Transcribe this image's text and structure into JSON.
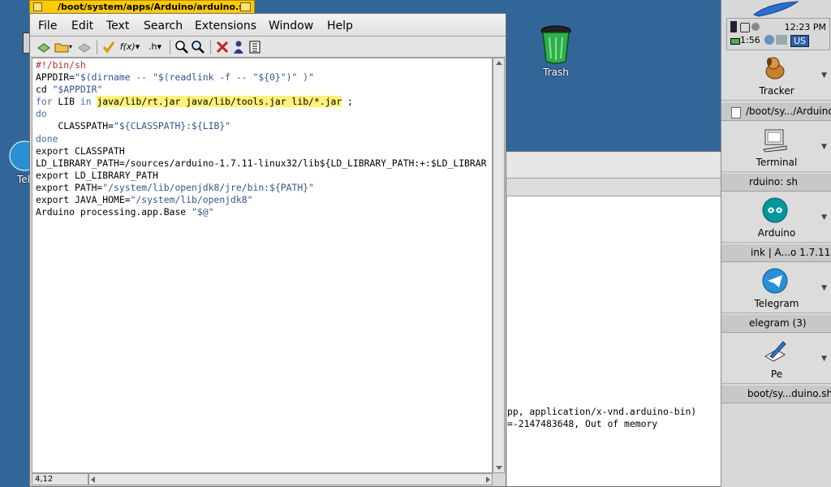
{
  "desktop": {
    "trash_label": "Trash",
    "left_icon_label": "Tel"
  },
  "pe": {
    "title": "/boot/system/apps/Arduino/arduino.sh",
    "menu": [
      "File",
      "Edit",
      "Text",
      "Search",
      "Extensions",
      "Window",
      "Help"
    ],
    "toolbar_func_label": "f(x)",
    "toolbar_header_label": ".h",
    "status": "4,12"
  },
  "code": {
    "l1": "#!/bin/sh",
    "l2a": "APPDIR=",
    "l2b": "\"$(dirname -- \"$(readlink -f -- \"${0}\")\" )\"",
    "l3a": "cd ",
    "l3b": "\"$APPDIR\"",
    "l4a": "for",
    "l4b": " LIB ",
    "l4c": "in",
    "l4d": " ",
    "l4e": "java/lib/rt.jar java/lib/tools.jar lib/*.jar",
    "l4f": " ;",
    "l5": "do",
    "l6a": "    CLASSPATH=",
    "l6b": "\"${CLASSPATH}:${LIB}\"",
    "l7": "done",
    "l8": "export CLASSPATH",
    "l9": "LD_LIBRARY_PATH=/sources/arduino-1.7.11-linux32/lib${LD_LIBRARY_PATH:+:$LD_LIBRAR",
    "l10": "export LD_LIBRARY_PATH",
    "l11a": "export PATH=",
    "l11b": "\"/system/lib/openjdk8/jre/bin:${PATH}\"",
    "l12a": "export JAVA_HOME=",
    "l12b": "\"/system/lib/openjdk8\"",
    "l13a": "Arduino processing.app.Base ",
    "l13b": "\"$@\""
  },
  "terminal": {
    "line1": "pp, application/x-vnd.arduino-bin)",
    "line2": "=-2147483648, Out of memory"
  },
  "deskbar": {
    "time": "12:23 PM",
    "battery": "1:56",
    "keymap": "US",
    "apps": [
      {
        "label": "Tracker",
        "window": "/boot/sy.../Arduino"
      },
      {
        "label": "Terminal",
        "window": "rduino: sh"
      },
      {
        "label": "Arduino",
        "window": "ink | A...o 1.7.11"
      },
      {
        "label": "Telegram",
        "window": "elegram (3)"
      },
      {
        "label": "Pe",
        "window": "boot/sy...duino.sh"
      }
    ]
  },
  "colors": {
    "desktop": "#336698",
    "tab": "#ffcb00",
    "highlight": "#fff27a"
  }
}
